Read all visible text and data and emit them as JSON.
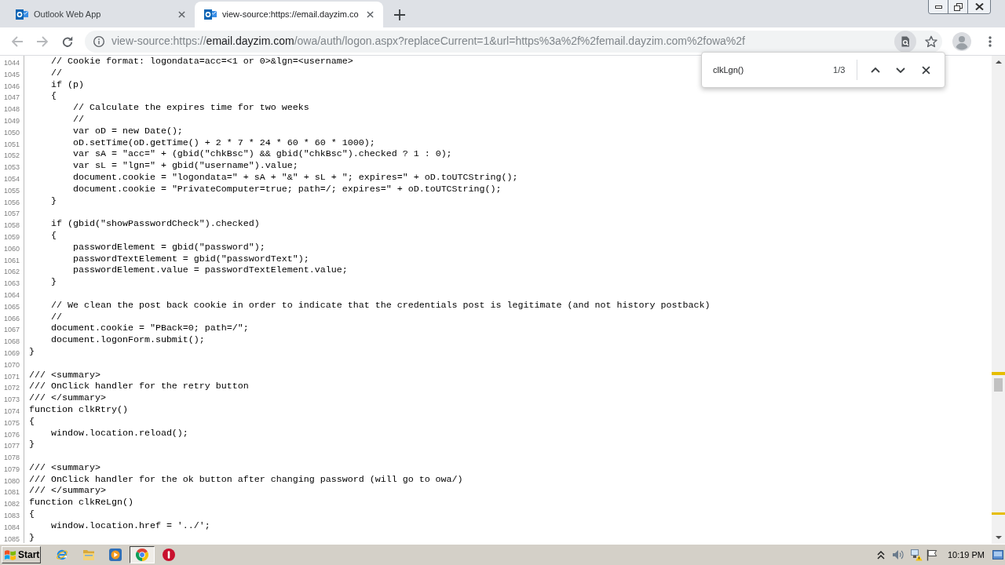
{
  "tabs": [
    {
      "title": "Outlook Web App",
      "selected": false
    },
    {
      "title": "view-source:https://email.dayzim.co",
      "selected": true
    }
  ],
  "address_bar": {
    "scheme": "view-source:https://",
    "host": "email.dayzim.com",
    "path": "/owa/auth/logon.aspx?replaceCurrent=1&url=https%3a%2f%2femail.dayzim.com%2fowa%2f"
  },
  "find_bar": {
    "query": "clkLgn()",
    "match_count": "1/3"
  },
  "source": {
    "lines": [
      {
        "number": "1044",
        "text": "    // Cookie format: logondata=acc=<1 or 0>&lgn=<username>"
      },
      {
        "number": "1045",
        "text": "    //"
      },
      {
        "number": "1046",
        "text": "    if (p)"
      },
      {
        "number": "1047",
        "text": "    {"
      },
      {
        "number": "1048",
        "text": "        // Calculate the expires time for two weeks"
      },
      {
        "number": "1049",
        "text": "        //"
      },
      {
        "number": "1050",
        "text": "        var oD = new Date();"
      },
      {
        "number": "1051",
        "text": "        oD.setTime(oD.getTime() + 2 * 7 * 24 * 60 * 60 * 1000);"
      },
      {
        "number": "1052",
        "text": "        var sA = \"acc=\" + (gbid(\"chkBsc\") && gbid(\"chkBsc\").checked ? 1 : 0);"
      },
      {
        "number": "1053",
        "text": "        var sL = \"lgn=\" + gbid(\"username\").value;"
      },
      {
        "number": "1054",
        "text": "        document.cookie = \"logondata=\" + sA + \"&\" + sL + \"; expires=\" + oD.toUTCString();"
      },
      {
        "number": "1055",
        "text": "        document.cookie = \"PrivateComputer=true; path=/; expires=\" + oD.toUTCString();"
      },
      {
        "number": "1056",
        "text": "    }"
      },
      {
        "number": "1057"
      },
      {
        "number": "1058",
        "text": "    if (gbid(\"showPasswordCheck\").checked)"
      },
      {
        "number": "1059",
        "text": "    {"
      },
      {
        "number": "1060",
        "text": "        passwordElement = gbid(\"password\");"
      },
      {
        "number": "1061",
        "text": "        passwordTextElement = gbid(\"passwordText\");"
      },
      {
        "number": "1062",
        "text": "        passwordElement.value = passwordTextElement.value;"
      },
      {
        "number": "1063",
        "text": "    }"
      },
      {
        "number": "1064"
      },
      {
        "number": "1065",
        "text": "    // We clean the post back cookie in order to indicate that the credentials post is legitimate (and not history postback)"
      },
      {
        "number": "1066",
        "text": "    //"
      },
      {
        "number": "1067",
        "text": "    document.cookie = \"PBack=0; path=/\";"
      },
      {
        "number": "1068",
        "text": "    document.logonForm.submit();"
      },
      {
        "number": "1069",
        "text": "}"
      },
      {
        "number": "1070"
      },
      {
        "number": "1071",
        "text": "/// <summary>"
      },
      {
        "number": "1072",
        "text": "/// OnClick handler for the retry button"
      },
      {
        "number": "1073",
        "text": "/// </summary>"
      },
      {
        "number": "1074",
        "text": "function clkRtry()"
      },
      {
        "number": "1075",
        "text": "{"
      },
      {
        "number": "1076",
        "text": "    window.location.reload();"
      },
      {
        "number": "1077",
        "text": "}"
      },
      {
        "number": "1078"
      },
      {
        "number": "1079",
        "text": "/// <summary>"
      },
      {
        "number": "1080",
        "text": "/// OnClick handler for the ok button after changing password (will go to owa/)"
      },
      {
        "number": "1081",
        "text": "/// </summary>"
      },
      {
        "number": "1082",
        "text": "function clkReLgn()"
      },
      {
        "number": "1083",
        "text": "{"
      },
      {
        "number": "1084",
        "text": "    window.location.href = '../';"
      },
      {
        "number": "1085",
        "text": "}"
      }
    ]
  },
  "taskbar": {
    "start_label": "Start",
    "apps": [
      {
        "kind": "ie",
        "selected": false
      },
      {
        "kind": "explorer",
        "selected": false
      },
      {
        "kind": "media",
        "selected": false
      },
      {
        "kind": "chrome",
        "selected": true
      },
      {
        "kind": "alert",
        "selected": false
      }
    ],
    "clock": "10:19 PM"
  }
}
